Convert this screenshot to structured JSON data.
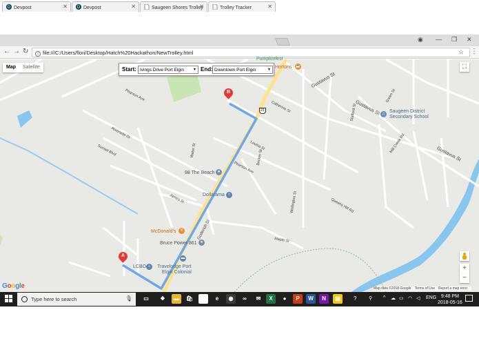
{
  "browser": {
    "tabs": [
      {
        "label": "Devpost",
        "icon": "devpost-icon"
      },
      {
        "label": "Devpost",
        "icon": "devpost-icon"
      },
      {
        "label": "Saugeen Shores Trolley",
        "icon": "page-icon"
      },
      {
        "label": "Trolley Tracker",
        "icon": "page-icon"
      }
    ],
    "url": "file:///C:/Users/flori/Desktop/Hatch%20Hackathon/NewTrolley.html"
  },
  "map": {
    "type_control": {
      "map": "Map",
      "satellite": "Satellite"
    },
    "route_panel": {
      "start_label": "Start:",
      "start_value": "Ivings Drive Port Elgin",
      "end_label": "End:",
      "end_value": "Downtown Port Elgin"
    },
    "markers": {
      "a": "A",
      "b": "B"
    },
    "highway_shield": "21",
    "poi": {
      "pumpkinfest": "Pumpkinfest",
      "hortons": "Hortons",
      "saugeen_line1": "Saugeen District",
      "saugeen_line2": "Secondary School",
      "the_beach": "98 The Beach",
      "dollarama": "Dollarama",
      "mcdonalds": "McDonald's",
      "bruce_power": "Bruce Power 861",
      "lcbo": "LCBO",
      "travelodge_line1": "Travelodge Port",
      "travelodge_line2": "Elgin Colonial"
    },
    "streets": {
      "gustavus_1": "Gustavus St",
      "gustavus_2": "Gustavus St",
      "gustavus_3": "Gustavus St",
      "goderich": "Goderich St",
      "pearson": "Pearson Ave",
      "pearson2": "Pearson Ave",
      "catherine": "Catherine St",
      "louisa": "Louisa St",
      "sunset": "Sunset Blvd",
      "riverside": "Riverside Dr",
      "mill_creek": "Mill Creek Rd",
      "queens": "Queens Hill Rd",
      "maple": "Maple St",
      "wellington": "Wellington St",
      "stafford": "Stafford St",
      "bricker": "Bricker St",
      "green": "Green St",
      "james": "James St",
      "water": "Water St"
    },
    "logo": {
      "g1": "G",
      "o1": "o",
      "o2": "o",
      "g2": "g",
      "l": "l",
      "e": "e",
      "colors": {
        "blue": "#4285F4",
        "red": "#EA4335",
        "yellow": "#FBBC05",
        "green": "#34A853"
      }
    },
    "attribution": {
      "data": "Map data ©2018 Google",
      "terms": "Terms of Use",
      "report": "Report a map error"
    },
    "zoom": {
      "in": "+",
      "out": "−"
    },
    "fullscreen_icon": "fullscreen-icon",
    "colors": {
      "route": "#6fa8e8",
      "water": "#88c6ee",
      "park": "#c9e5b4",
      "road": "#ffffff",
      "highway": "#ffe28a",
      "background": "#e9e9e6"
    }
  },
  "taskbar": {
    "search_placeholder": "Type here to search",
    "language": "ENG",
    "time": "9:48 PM",
    "date": "2018-05-16",
    "apps": [
      {
        "name": "task-view-icon",
        "glyph": "▭",
        "color": "#1f1f1f"
      },
      {
        "name": "dropbox-icon",
        "glyph": "❖",
        "color": "#1f1f1f"
      },
      {
        "name": "file-explorer-icon",
        "glyph": "▬",
        "color": "#e8b923"
      },
      {
        "name": "store-icon",
        "glyph": "🛍",
        "color": "#1f1f1f"
      },
      {
        "name": "amazon-icon",
        "glyph": "a",
        "color": "#ffffff"
      },
      {
        "name": "edge-icon",
        "glyph": "e",
        "color": "#1f1f1f"
      },
      {
        "name": "chrome-icon",
        "glyph": "◉",
        "color": "#3a3a3a"
      },
      {
        "name": "loop-icon",
        "glyph": "∞",
        "color": "#1f1f1f"
      },
      {
        "name": "mail-icon",
        "glyph": "✉",
        "color": "#1f1f1f"
      },
      {
        "name": "excel-icon",
        "glyph": "X",
        "color": "#1e7145"
      },
      {
        "name": "spotify-icon",
        "glyph": "●",
        "color": "#1f1f1f"
      },
      {
        "name": "powerpoint-icon",
        "glyph": "P",
        "color": "#c43e1c"
      },
      {
        "name": "word-icon",
        "glyph": "W",
        "color": "#2b579a"
      },
      {
        "name": "onenote-icon",
        "glyph": "N",
        "color": "#7719aa"
      },
      {
        "name": "notes-icon",
        "glyph": "▤",
        "color": "#f2c811"
      }
    ]
  }
}
